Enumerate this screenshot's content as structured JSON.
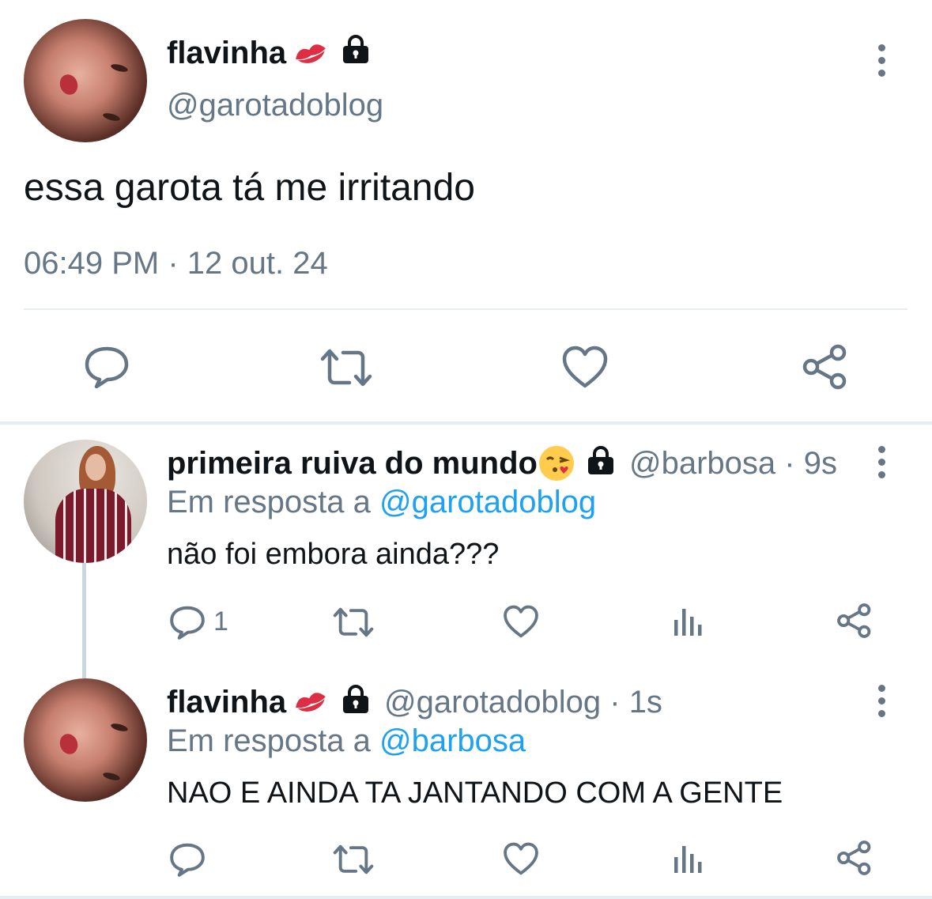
{
  "main_tweet": {
    "name": "flavinha",
    "handle": "@garotadoblog",
    "text": "essa garota tá me irritando",
    "timestamp": "06:49 PM · 12 out. 24"
  },
  "replies": [
    {
      "name": "primeira ruiva do mundo",
      "handle_time": "@barbosa · 9s",
      "reply_prefix": "Em resposta a",
      "reply_mention": "@garotadoblog",
      "text": "não foi embora ainda???",
      "reply_count": "1"
    },
    {
      "name": "flavinha",
      "handle_time": "@garotadoblog · 1s",
      "reply_prefix": "Em resposta a",
      "reply_mention": "@barbosa",
      "text": "NAO E AINDA TA JANTANDO COM A GENTE"
    }
  ],
  "icons": {
    "verified_emoji_1": "kiss-mark-icon",
    "verified_emoji_2": "kissing-face-icon",
    "protected": "lock-icon",
    "reply": "speech-bubble-icon",
    "retweet": "retweet-arrows-icon",
    "like": "heart-icon",
    "share": "share-icon",
    "analytics": "bar-chart-icon",
    "more": "vertical-dots-icon"
  },
  "colors": {
    "text_primary": "#0f1419",
    "text_secondary": "#657786",
    "mention": "#1da1f2",
    "divider": "#e6ecf0",
    "kiss_red": "#dd2e44"
  }
}
